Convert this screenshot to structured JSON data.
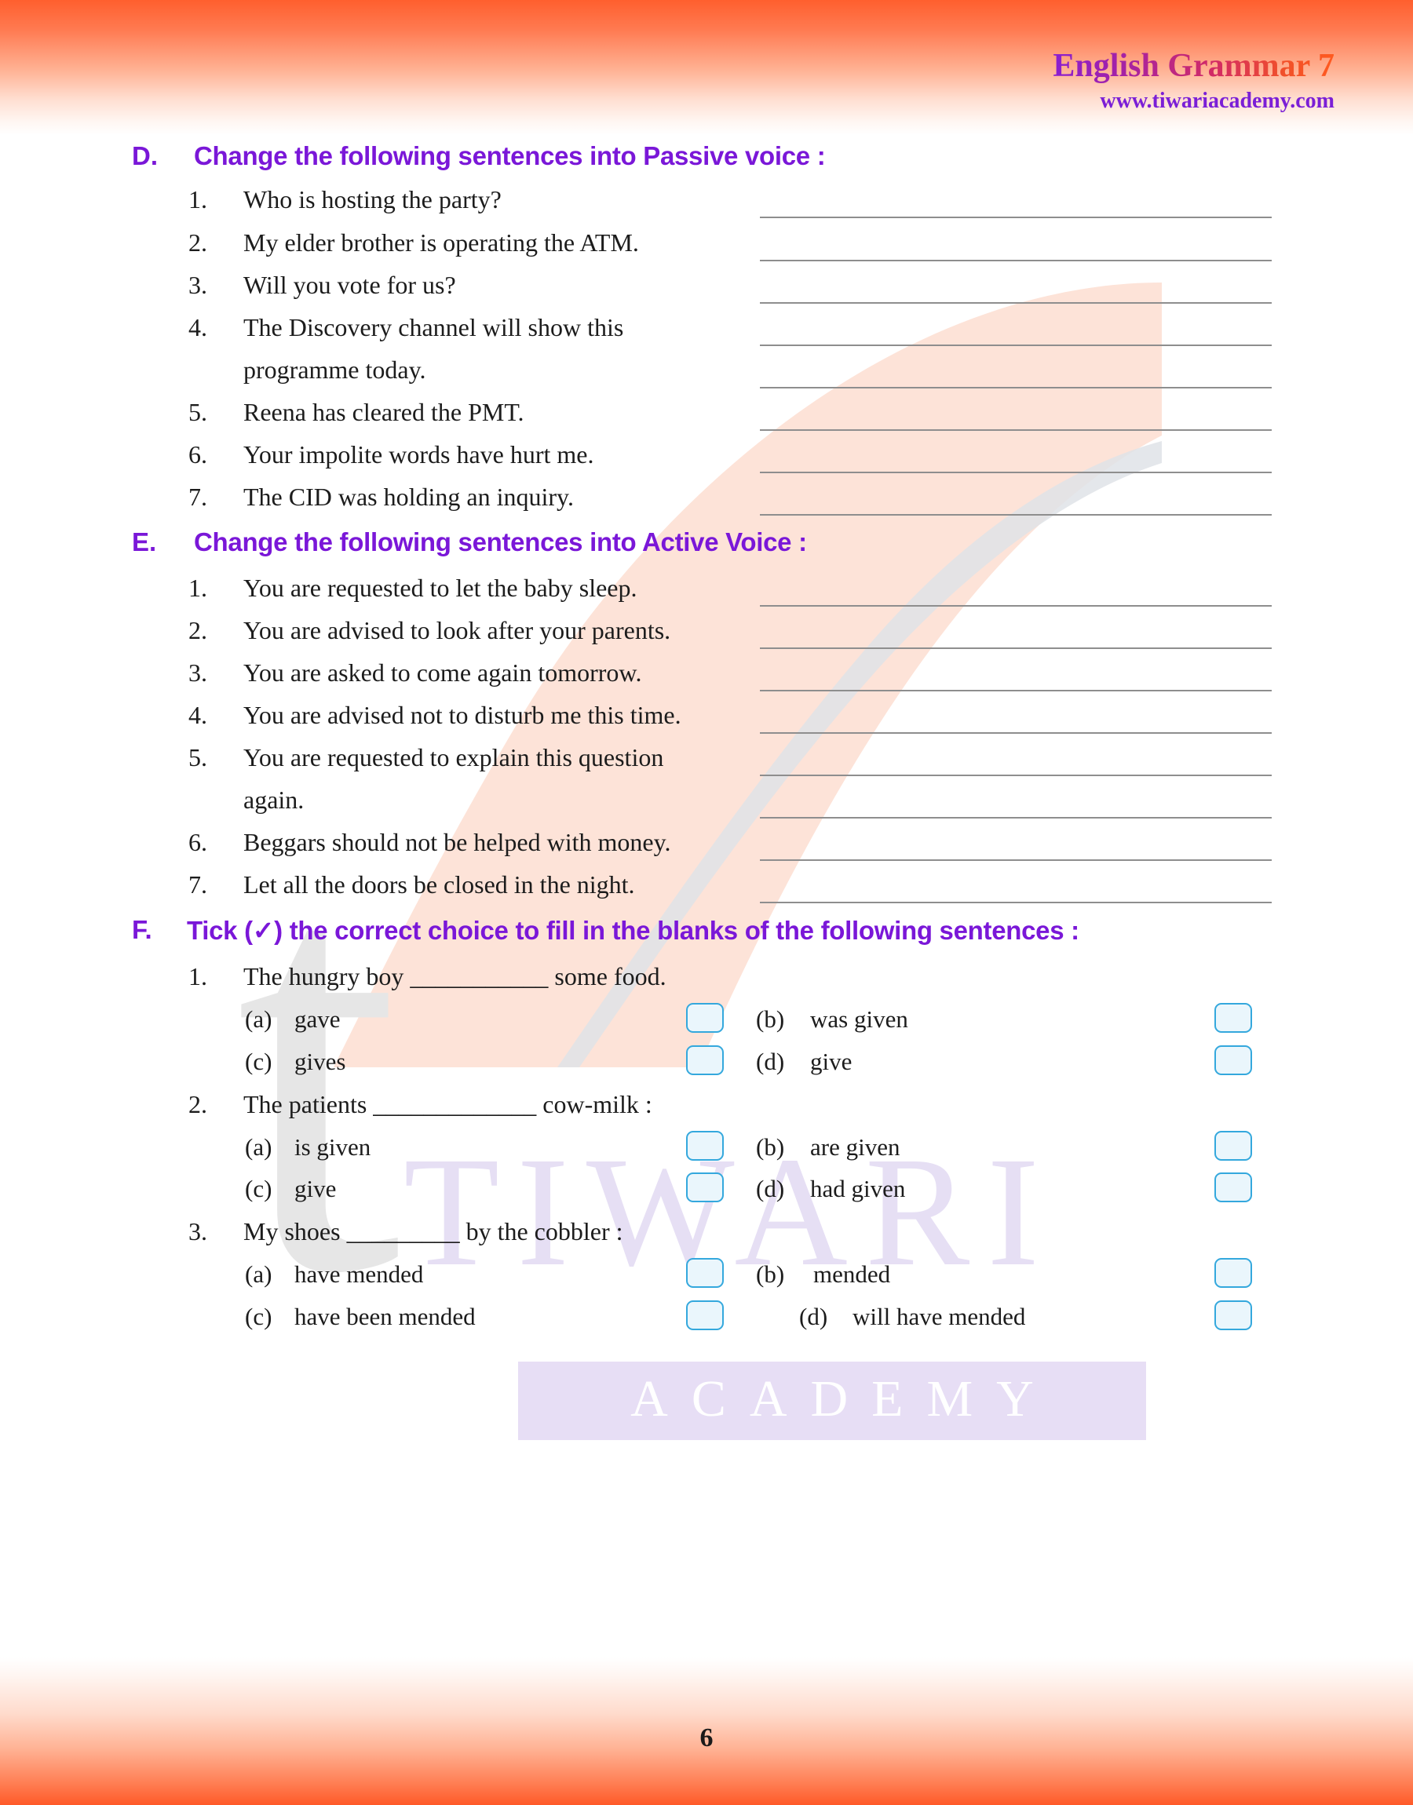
{
  "header": {
    "title": "English Grammar 7",
    "url": "www.tiwariacademy.com"
  },
  "watermark": {
    "letter": "t",
    "brand": "TIWARI",
    "sub": "ACADEMY"
  },
  "footer": {
    "page_number": "6"
  },
  "colors": {
    "heading_purple": "#7a17d8",
    "band_orange": "#ff5f2e",
    "checkbox_border": "#34a8dd",
    "checkbox_fill": "#eaf6fc",
    "answer_line": "#8e8e8e",
    "watermark_purple": "#e6dff4",
    "watermark_gray": "#e6e6e6",
    "watermark_peach": "#fde3d8"
  },
  "sections": [
    {
      "letter": "D.",
      "title": "Change the following sentences into Passive voice :",
      "items": [
        {
          "num": "1.",
          "lines": [
            "Who is hosting the party?"
          ]
        },
        {
          "num": "2.",
          "lines": [
            "My elder brother is operating the ATM."
          ]
        },
        {
          "num": "3.",
          "lines": [
            "Will you vote for us?"
          ]
        },
        {
          "num": "4.",
          "lines": [
            "The Discovery channel will show this",
            "programme today."
          ]
        },
        {
          "num": "5.",
          "lines": [
            "Reena has cleared the PMT."
          ]
        },
        {
          "num": "6.",
          "lines": [
            "Your impolite words have hurt me."
          ]
        },
        {
          "num": "7.",
          "lines": [
            "The CID was holding an inquiry."
          ]
        }
      ]
    },
    {
      "letter": "E.",
      "title": "Change the following sentences into Active Voice :",
      "items": [
        {
          "num": "1.",
          "lines": [
            "You are requested to let the baby sleep."
          ]
        },
        {
          "num": "2.",
          "lines": [
            "You are advised to look after your parents."
          ]
        },
        {
          "num": "3.",
          "lines": [
            "You are asked to come again tomorrow."
          ]
        },
        {
          "num": "4.",
          "lines": [
            "You are advised not to disturb me this time."
          ]
        },
        {
          "num": "5.",
          "lines": [
            "You are requested to explain this question",
            "again."
          ]
        },
        {
          "num": "6.",
          "lines": [
            "Beggars should not be helped with money."
          ]
        },
        {
          "num": "7.",
          "lines": [
            "Let all the doors be closed in the night."
          ]
        }
      ]
    },
    {
      "letter": "F.",
      "title": "Tick (✓) the correct choice to fill in the blanks of the following sentences :",
      "questions": [
        {
          "num": "1.",
          "stem": "The hungry boy ___________ some food.",
          "options": [
            {
              "tag": "(a)",
              "text": "gave"
            },
            {
              "tag": "(b)",
              "text": "was given"
            },
            {
              "tag": "(c)",
              "text": "gives"
            },
            {
              "tag": "(d)",
              "text": "give"
            }
          ]
        },
        {
          "num": "2.",
          "stem": "The patients _____________ cow-milk :",
          "options": [
            {
              "tag": "(a)",
              "text": "is given"
            },
            {
              "tag": "(b)",
              "text": "are given"
            },
            {
              "tag": "(c)",
              "text": "give"
            },
            {
              "tag": "(d)",
              "text": "had given"
            }
          ]
        },
        {
          "num": "3.",
          "stem": "My shoes _________ by the cobbler :",
          "options": [
            {
              "tag": "(a)",
              "text": "have mended"
            },
            {
              "tag": "(b)",
              "text": "mended"
            },
            {
              "tag": "(c)",
              "text": "have been mended"
            },
            {
              "tag": "(d)",
              "text": "will have mended"
            }
          ]
        }
      ]
    }
  ]
}
